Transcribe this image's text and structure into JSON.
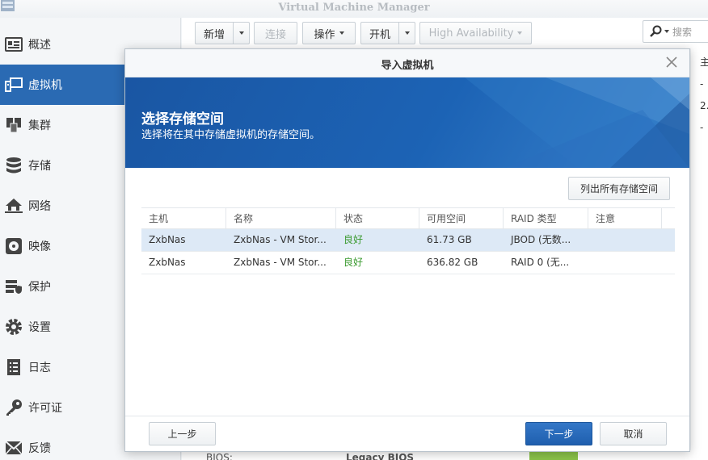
{
  "app": {
    "title": "Virtual Machine Manager"
  },
  "sidebar": {
    "items": [
      {
        "label": "概述",
        "icon": "overview-icon"
      },
      {
        "label": "虚拟机",
        "icon": "vm-icon",
        "active": true
      },
      {
        "label": "集群",
        "icon": "cluster-icon"
      },
      {
        "label": "存储",
        "icon": "storage-icon"
      },
      {
        "label": "网络",
        "icon": "network-icon"
      },
      {
        "label": "映像",
        "icon": "image-icon"
      },
      {
        "label": "保护",
        "icon": "protection-icon"
      },
      {
        "label": "设置",
        "icon": "settings-icon"
      },
      {
        "label": "日志",
        "icon": "log-icon"
      },
      {
        "label": "许可证",
        "icon": "license-icon"
      },
      {
        "label": "反馈",
        "icon": "feedback-icon"
      }
    ]
  },
  "toolbar": {
    "new_label": "新增",
    "connect_label": "连接",
    "action_label": "操作",
    "power_on_label": "开机",
    "ha_label": "High Availability",
    "search_placeholder": "搜索"
  },
  "background": {
    "col_header": "主",
    "cells": [
      "-",
      "2.",
      "-"
    ],
    "bottom_bios_label": "BIOS:",
    "bottom_bios_value": "Legacy BIOS"
  },
  "dialog": {
    "title": "导入虚拟机",
    "banner_title": "选择存储空间",
    "banner_subtitle": "选择将在其中存储虚拟机的存储空间。",
    "list_all_label": "列出所有存储空间",
    "columns": [
      "主机",
      "名称",
      "状态",
      "可用空间",
      "RAID 类型",
      "注意"
    ],
    "rows": [
      {
        "host": "ZxbNas",
        "name": "ZxbNas - VM Stor...",
        "status": "良好",
        "free": "61.73 GB",
        "raid": "JBOD (无数...",
        "note": "",
        "selected": true
      },
      {
        "host": "ZxbNas",
        "name": "ZxbNas - VM Stor...",
        "status": "良好",
        "free": "636.82 GB",
        "raid": "RAID 0 (无...",
        "note": "",
        "selected": false
      }
    ],
    "back_label": "上一步",
    "next_label": "下一步",
    "cancel_label": "取消"
  },
  "colors": {
    "accent": "#2a6ab3",
    "banner": "#1c63b5",
    "status_ok": "#3a9a2f"
  }
}
